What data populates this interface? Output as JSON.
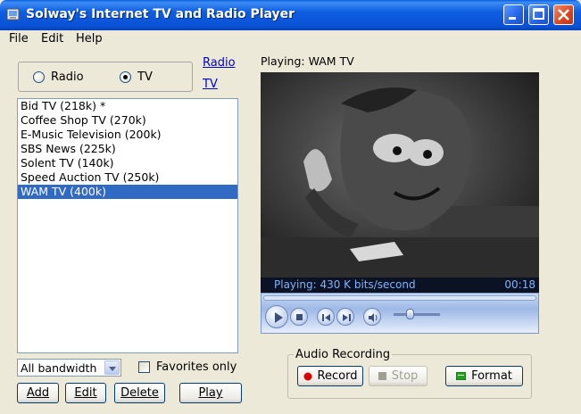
{
  "window": {
    "title": "Solway's Internet TV and Radio Player"
  },
  "menu": [
    "File",
    "Edit",
    "Help"
  ],
  "mode": {
    "radio_label": "Radio",
    "tv_label": "TV",
    "selected": "TV"
  },
  "links": {
    "radio": "Radio",
    "tv": "TV"
  },
  "channels": [
    {
      "label": "Bid TV  (218k) *",
      "selected": false
    },
    {
      "label": "Coffee Shop TV  (270k)",
      "selected": false
    },
    {
      "label": "E-Music Television  (200k)",
      "selected": false
    },
    {
      "label": "SBS News  (225k)",
      "selected": false
    },
    {
      "label": "Solent TV  (140k)",
      "selected": false
    },
    {
      "label": "Speed Auction TV  (250k)",
      "selected": false
    },
    {
      "label": "WAM TV  (400k)",
      "selected": true
    }
  ],
  "bandwidth": {
    "value": "All bandwidth"
  },
  "favorites": {
    "label": "Favorites only",
    "checked": false
  },
  "buttons": {
    "add": "Add",
    "edit": "Edit",
    "delete": "Delete",
    "play": "Play"
  },
  "player": {
    "playing_label": "Playing: WAM TV",
    "status": "Playing: 430 K bits/second",
    "time": "00:18",
    "volume_fraction": 0.35
  },
  "recording": {
    "group_label": "Audio Recording",
    "record": "Record",
    "stop": "Stop",
    "format": "Format"
  },
  "colors": {
    "selection": "#316ac5",
    "link": "#0000cc",
    "record_dot": "#e00000"
  }
}
